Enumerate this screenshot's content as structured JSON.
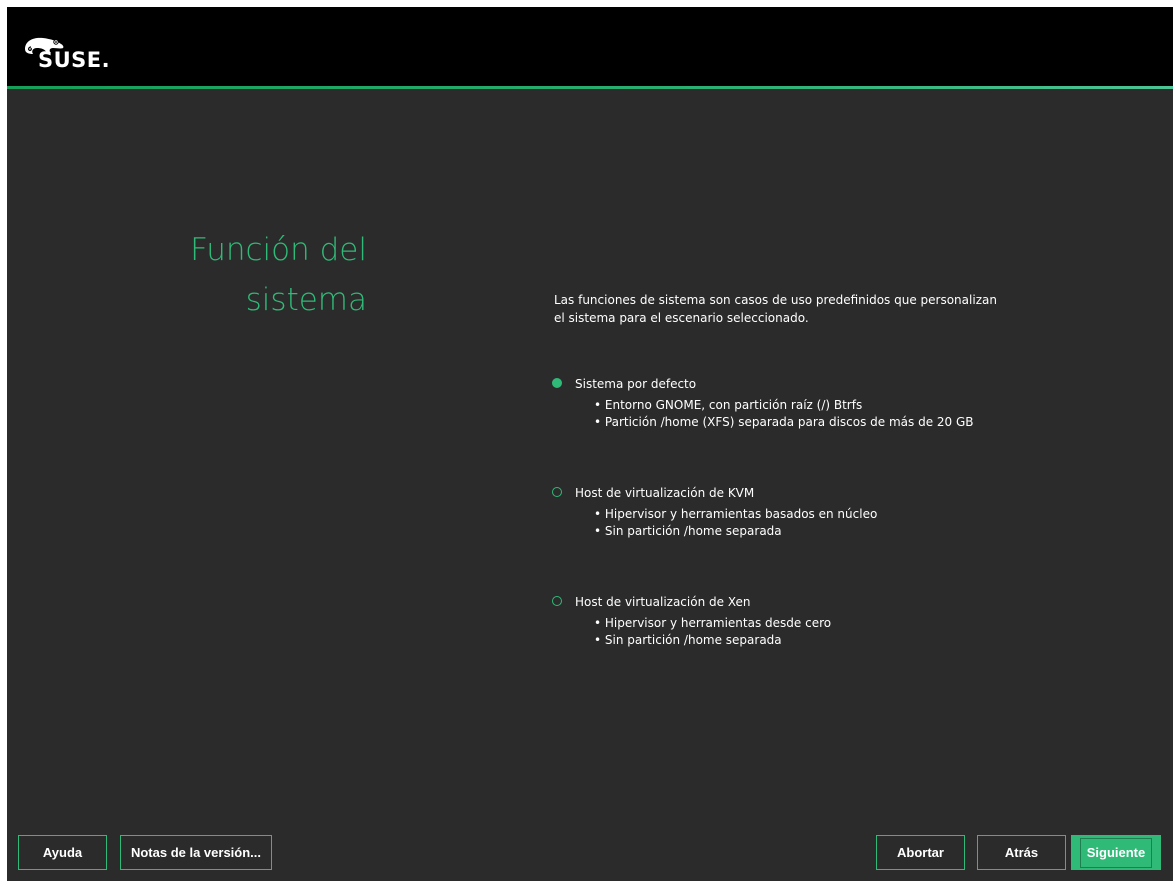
{
  "header": {
    "brand": "SUSE."
  },
  "page": {
    "title_line1": "Función del",
    "title_line2": "sistema",
    "description_line1": "Las funciones de sistema son casos de uso predefinidos que personalizan",
    "description_line2": "el sistema para el escenario seleccionado."
  },
  "roles": [
    {
      "label": "Sistema por defecto",
      "selected": true,
      "bullets": [
        "Entorno GNOME, con partición raíz (/) Btrfs",
        "Partición /home (XFS) separada para discos de más de 20 GB"
      ]
    },
    {
      "label": "Host de virtualización de KVM",
      "selected": false,
      "bullets": [
        "Hipervisor y herramientas basados en núcleo",
        "Sin partición /home separada"
      ]
    },
    {
      "label": "Host de virtualización de Xen",
      "selected": false,
      "bullets": [
        "Hipervisor y herramientas desde cero",
        "Sin partición /home separada"
      ]
    }
  ],
  "buttons": {
    "help": "Ayuda",
    "release_notes": "Notas de la versión...",
    "abort": "Abortar",
    "back": "Atrás",
    "next": "Siguiente"
  },
  "colors": {
    "accent": "#30ba78",
    "background": "#2b2b2b",
    "header": "#000000"
  },
  "icons": {
    "logo": "suse-chameleon-logo"
  }
}
